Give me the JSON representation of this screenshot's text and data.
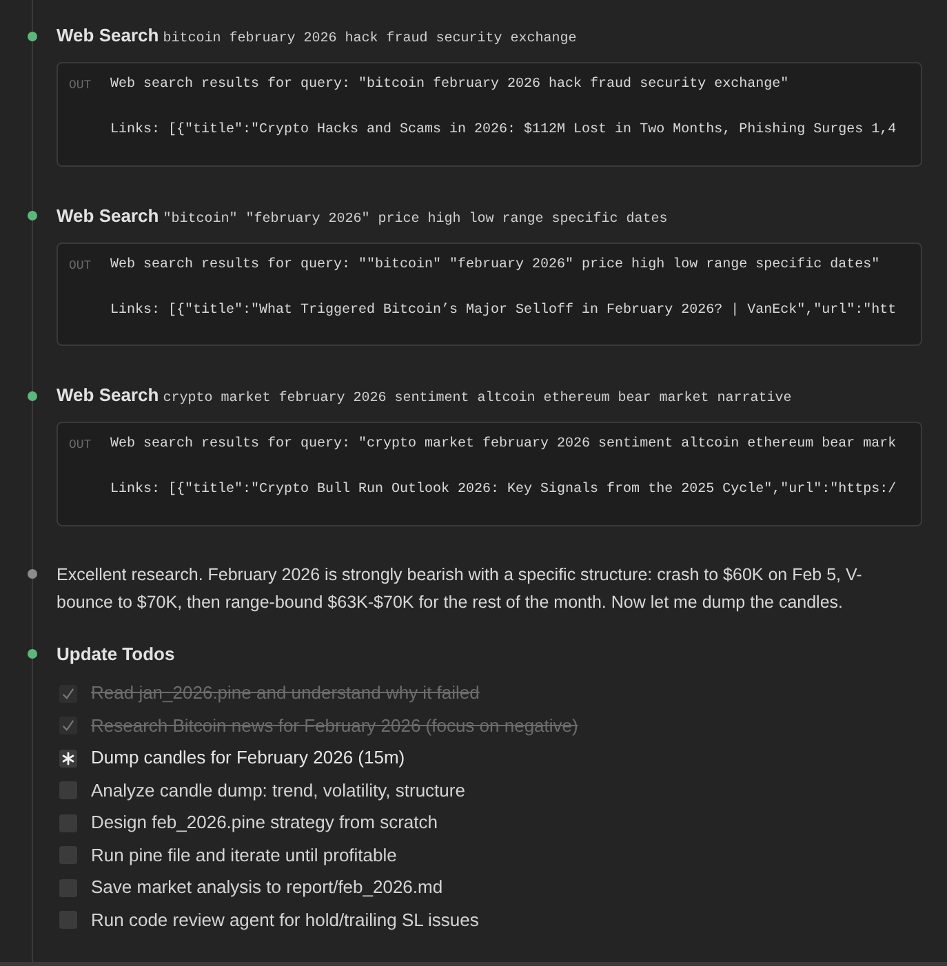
{
  "timeline": [
    {
      "kind": "tool",
      "color": "#5cb87a",
      "tool": "Web Search",
      "query": "bitcoin february 2026 hack fraud security exchange",
      "output": {
        "label": "OUT",
        "lines": [
          "Web search results for query: \"bitcoin february 2026 hack fraud security exchange\"",
          "Links: [{\"title\":\"Crypto Hacks and Scams in 2026: $112M Lost in Two Months, Phishing Surges 1,4"
        ]
      }
    },
    {
      "kind": "tool",
      "color": "#5cb87a",
      "tool": "Web Search",
      "query": "\"bitcoin\" \"february 2026\" price high low range specific dates",
      "output": {
        "label": "OUT",
        "lines": [
          "Web search results for query: \"\"bitcoin\" \"february 2026\" price high low range specific dates\"",
          "Links: [{\"title\":\"What Triggered Bitcoin’s Major Selloff in February 2026? | VanEck\",\"url\":\"htt"
        ]
      }
    },
    {
      "kind": "tool",
      "color": "#5cb87a",
      "tool": "Web Search",
      "query": "crypto market february 2026 sentiment altcoin ethereum bear market narrative",
      "output": {
        "label": "OUT",
        "lines": [
          "Web search results for query: \"crypto market february 2026 sentiment altcoin ethereum bear mark",
          "Links: [{\"title\":\"Crypto Bull Run Outlook 2026: Key Signals from the 2025 Cycle\",\"url\":\"https:/"
        ]
      }
    },
    {
      "kind": "message",
      "color": "#8c8c8c",
      "text": "Excellent research. February 2026 is strongly bearish with a specific structure: crash to $60K on Feb 5, V-bounce to $70K, then range-bound $63K-$70K for the rest of the month. Now let me dump the candles."
    },
    {
      "kind": "todos",
      "color": "#5cb87a",
      "title": "Update Todos",
      "todos": [
        {
          "text": "Read jan_2026.pine and understand why it failed",
          "completed": true,
          "in_progress": false
        },
        {
          "text": "Research Bitcoin news for February 2026 (focus on negative)",
          "completed": true,
          "in_progress": false
        },
        {
          "text": "Dump candles for February 2026 (15m)",
          "completed": false,
          "in_progress": true
        },
        {
          "text": "Analyze candle dump: trend, volatility, structure",
          "completed": false,
          "in_progress": false
        },
        {
          "text": "Design feb_2026.pine strategy from scratch",
          "completed": false,
          "in_progress": false
        },
        {
          "text": "Run pine file and iterate until profitable",
          "completed": false,
          "in_progress": false
        },
        {
          "text": "Save market analysis to report/feb_2026.md",
          "completed": false,
          "in_progress": false
        },
        {
          "text": "Run code review agent for hold/trailing SL issues",
          "completed": false,
          "in_progress": false
        }
      ]
    }
  ]
}
